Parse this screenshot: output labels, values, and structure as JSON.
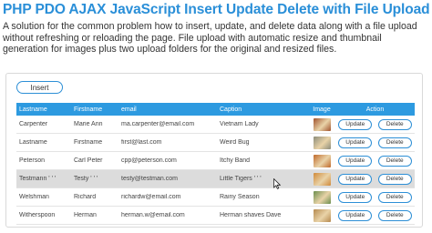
{
  "header": {
    "title": "PHP PDO AJAX JavaScript Insert Update Delete with File Upload",
    "description": "A solution for the common problem how to insert, update, and delete data along with a file upload without refreshing or reloading the page. File upload with automatic resize and thumbnail generation for images plus two upload folders for the original and resized files."
  },
  "toolbar": {
    "insert_label": "Insert"
  },
  "table": {
    "columns": {
      "lastname": "Lastname",
      "firstname": "Firstname",
      "email": "email",
      "caption": "Caption",
      "image": "Image",
      "action": "Action"
    },
    "update_label": "Update",
    "delete_label": "Delete",
    "rows": [
      {
        "lastname": "Carpenter",
        "firstname": "Marie Ann",
        "email": "ma.carpenter@email.com",
        "caption": "Vietnam Lady",
        "thumb_color": "#a0522d"
      },
      {
        "lastname": "Lastname",
        "firstname": "Firstname",
        "email": "first@last.com",
        "caption": "Weird Bug",
        "thumb_color": "#8c8c7a"
      },
      {
        "lastname": "Peterson",
        "firstname": "Carl Peter",
        "email": "cpp@peterson.com",
        "caption": "Itchy Band",
        "thumb_color": "#c06a2b"
      },
      {
        "lastname": "Testmann ' ' '",
        "firstname": "Testy ' ' '",
        "email": "testy@testman.com",
        "caption": "Little Tigers ' ' '",
        "thumb_color": "#d08a3a"
      },
      {
        "lastname": "Welshman",
        "firstname": "Richard",
        "email": "richardw@email.com",
        "caption": "Rainy Season",
        "thumb_color": "#6b8e4e"
      },
      {
        "lastname": "Witherspoon",
        "firstname": "Herman",
        "email": "herman.w@email.com",
        "caption": "Herman shaves Dave",
        "thumb_color": "#b5894f"
      }
    ]
  },
  "colors": {
    "accent": "#2d9ae0",
    "title": "#2a8fd8",
    "highlight_row": "#dcdcdc"
  }
}
